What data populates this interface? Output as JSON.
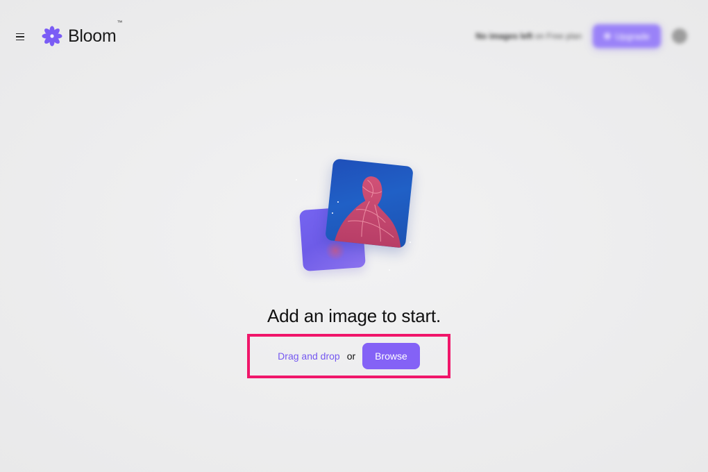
{
  "header": {
    "logo_text": "Bloom",
    "logo_tm": "™",
    "credits_count": "No images left",
    "credits_suffix": "on Free plan",
    "upgrade_label": "Upgrade"
  },
  "main": {
    "headline": "Add an image to start.",
    "drag_label": "Drag and drop",
    "or_label": "or",
    "browse_label": "Browse"
  },
  "colors": {
    "accent": "#8462f6",
    "highlight_border": "#f0166a"
  },
  "icons": {
    "menu": "hamburger-icon",
    "logo": "flower-logo-icon"
  }
}
